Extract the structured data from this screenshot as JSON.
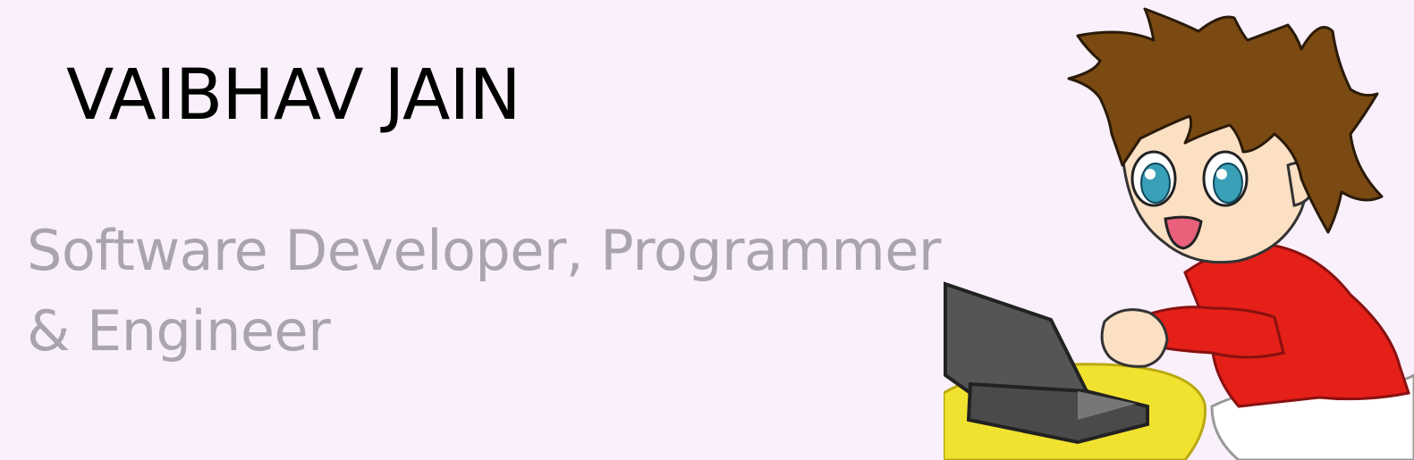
{
  "profile": {
    "name": "VAIBHAV JAIN",
    "tagline": "Software Developer, Programmer & Engineer"
  },
  "illustration": {
    "icon": "cartoon-boy-with-laptop-icon"
  },
  "colors": {
    "background": "#f9f0fc",
    "name": "#000000",
    "tagline": "#aaa4b0",
    "hair": "#7a4a12",
    "skin": "#fbe0c4",
    "eyes": "#3aa0b8",
    "shirt": "#e42018",
    "laptop": "#555555",
    "desk": "#f2e230",
    "pants": "#ffffff"
  }
}
